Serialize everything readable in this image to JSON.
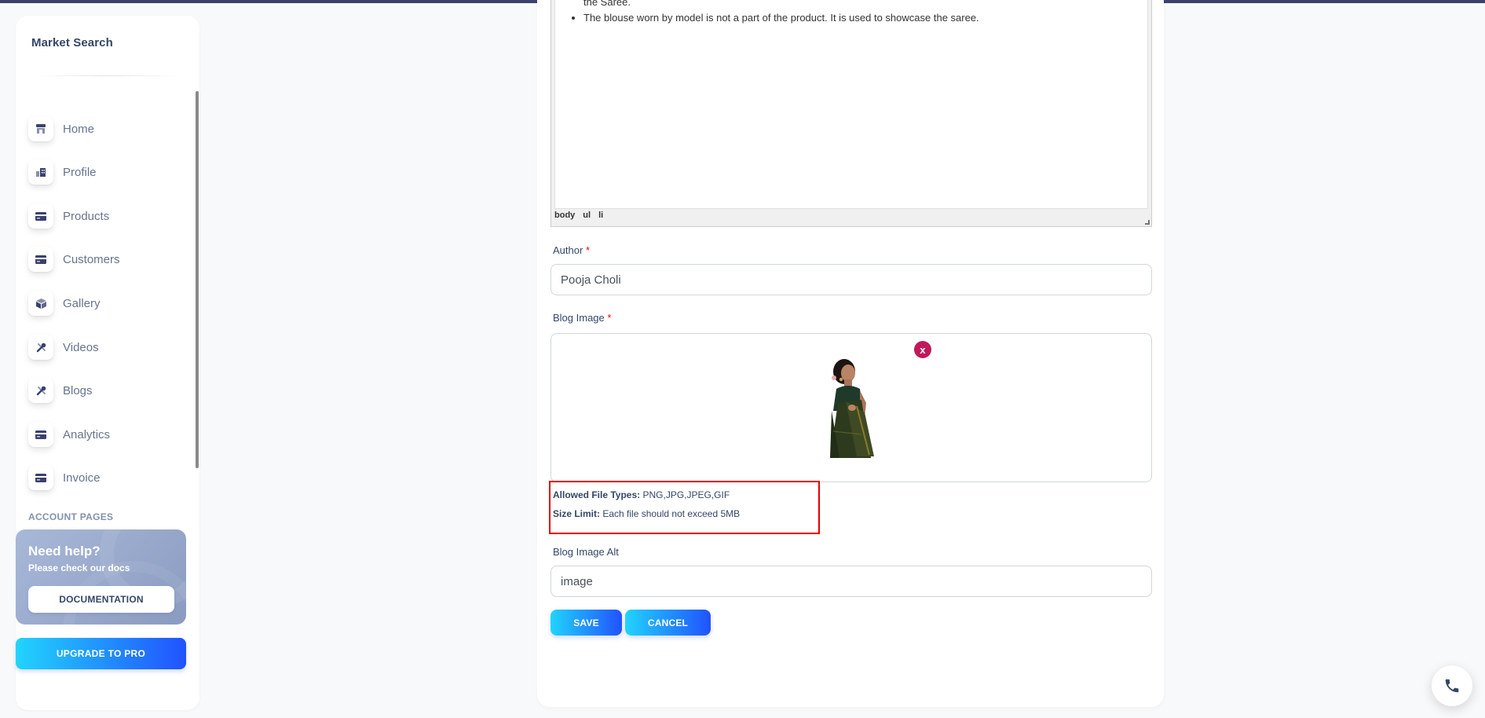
{
  "sidebar": {
    "brand": "Market Search",
    "items": [
      {
        "label": "Home",
        "icon": "shop-icon"
      },
      {
        "label": "Profile",
        "icon": "office-icon"
      },
      {
        "label": "Products",
        "icon": "credit-card-icon"
      },
      {
        "label": "Customers",
        "icon": "credit-card-icon"
      },
      {
        "label": "Gallery",
        "icon": "box-icon"
      },
      {
        "label": "Videos",
        "icon": "settings-tools-icon"
      },
      {
        "label": "Blogs",
        "icon": "settings-tools-icon"
      },
      {
        "label": "Analytics",
        "icon": "credit-card-icon"
      },
      {
        "label": "Invoice",
        "icon": "credit-card-icon"
      }
    ],
    "section_title": "ACCOUNT PAGES",
    "help": {
      "title": "Need help?",
      "subtitle": "Please check our docs",
      "button": "DOCUMENTATION"
    },
    "upgrade_button": "UPGRADE TO PRO"
  },
  "editor": {
    "lines": [
      "the Saree.",
      "The blouse worn by model is not a part of the product. It is used to showcase the saree."
    ],
    "status_path": [
      "body",
      "ul",
      "li"
    ]
  },
  "form": {
    "author_label": "Author",
    "author_value": "Pooja Choli",
    "blog_image_label": "Blog Image",
    "remove_glyph": "x",
    "required_mark": "*",
    "allowed_types_label": "Allowed File Types:",
    "allowed_types_value": "PNG,JPG,JPEG,GIF",
    "size_limit_label": "Size Limit:",
    "size_limit_value": "Each file should not exceed 5MB",
    "alt_label": "Blog Image Alt",
    "alt_value": "image",
    "save_button": "SAVE",
    "cancel_button": "CANCEL"
  },
  "colors": {
    "accent_gradient_start": "#21d4fd",
    "accent_gradient_end": "#2152ff",
    "required": "#ea0606",
    "highlight_border": "#e00000",
    "remove_button": "#c2185b"
  }
}
